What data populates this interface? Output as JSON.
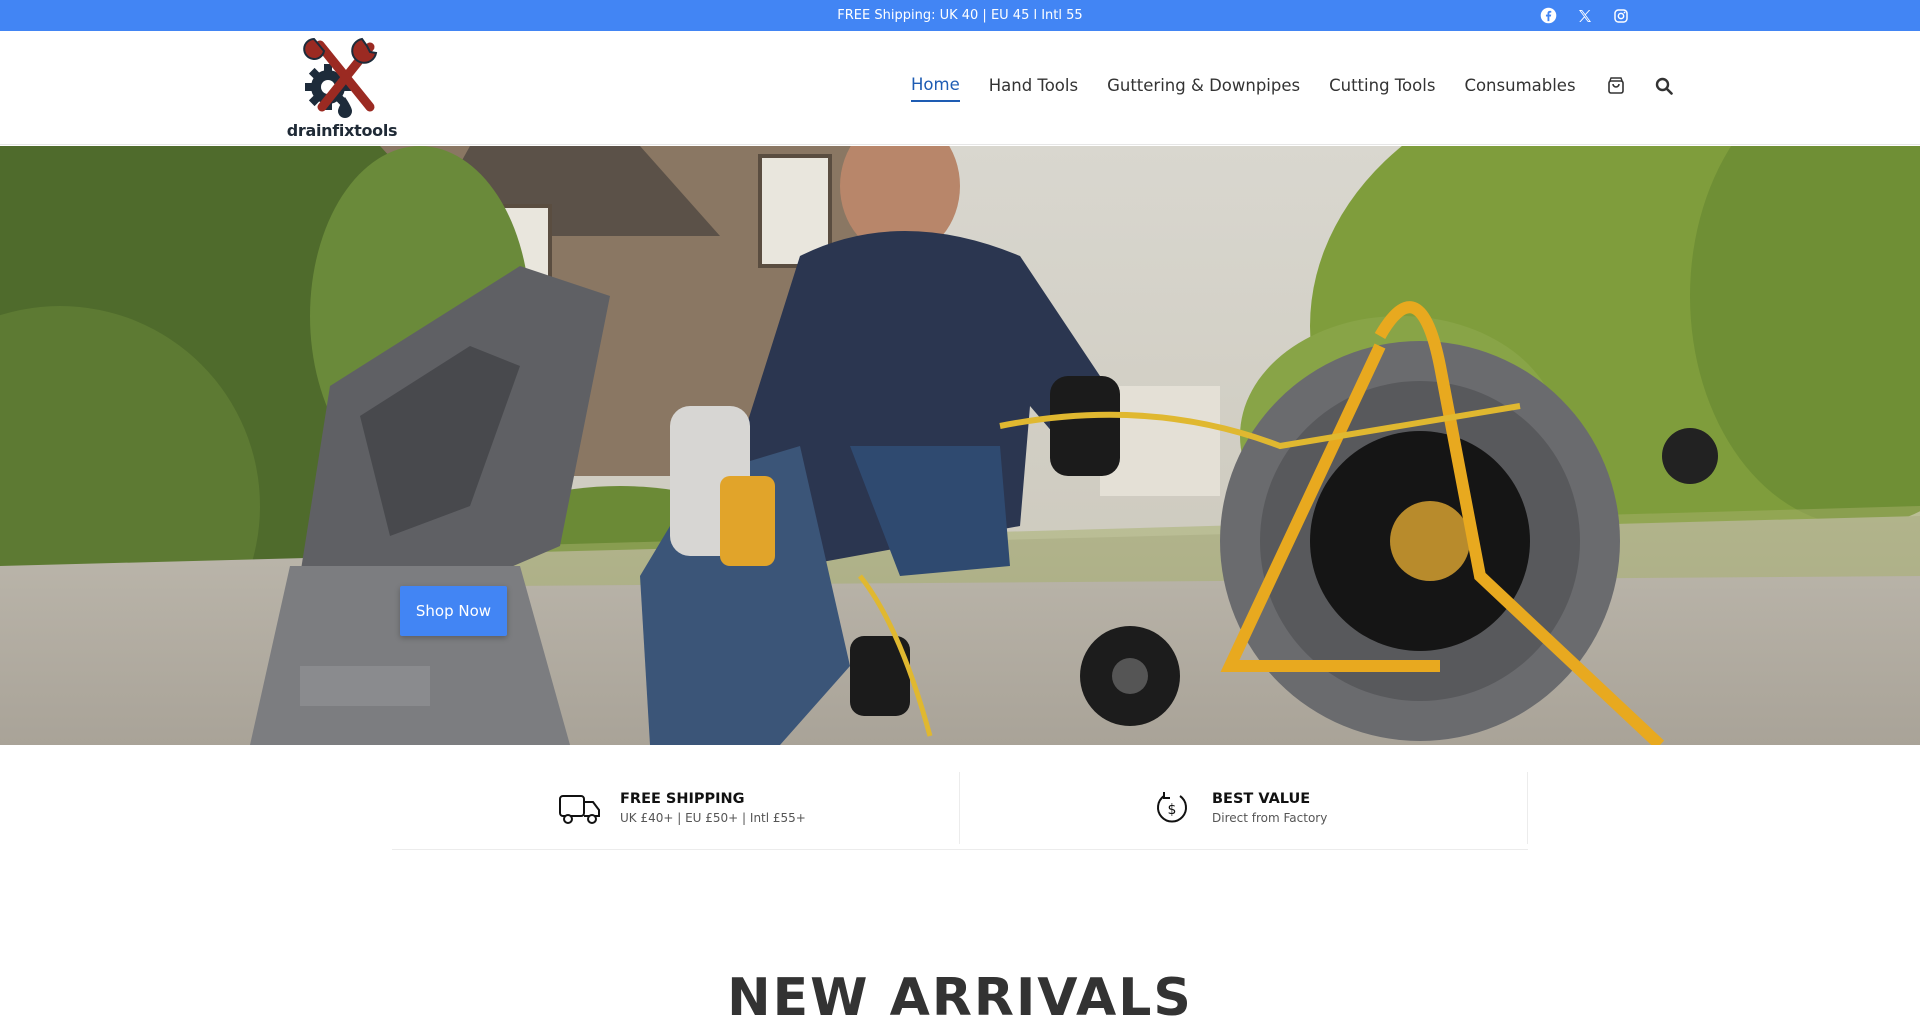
{
  "topbar": {
    "announcement": "FREE Shipping: UK   40 | EU   45 l Intl   55",
    "socials": [
      "facebook-icon",
      "x-twitter-icon",
      "instagram-icon"
    ]
  },
  "header": {
    "logo_text": "drainfixtools",
    "nav": [
      {
        "label": "Home",
        "active": true
      },
      {
        "label": "Hand Tools",
        "active": false
      },
      {
        "label": "Guttering & Downpipes",
        "active": false
      },
      {
        "label": "Cutting Tools",
        "active": false
      },
      {
        "label": "Consumables",
        "active": false
      }
    ],
    "icons": [
      "cart-icon",
      "search-icon"
    ]
  },
  "hero": {
    "button_label": "Shop Now"
  },
  "features": [
    {
      "icon": "truck-icon",
      "title": "FREE SHIPPING",
      "subtitle": "UK £40+ | EU £50+ | Intl £55+"
    },
    {
      "icon": "dollar-cycle-icon",
      "title": "BEST VALUE",
      "subtitle": "Direct from Factory"
    }
  ],
  "section": {
    "title": "NEW ARRIVALS"
  },
  "colors": {
    "accent": "#4285f4",
    "nav_active": "#1e5cb3",
    "tool_yellow": "#e8a91f"
  }
}
